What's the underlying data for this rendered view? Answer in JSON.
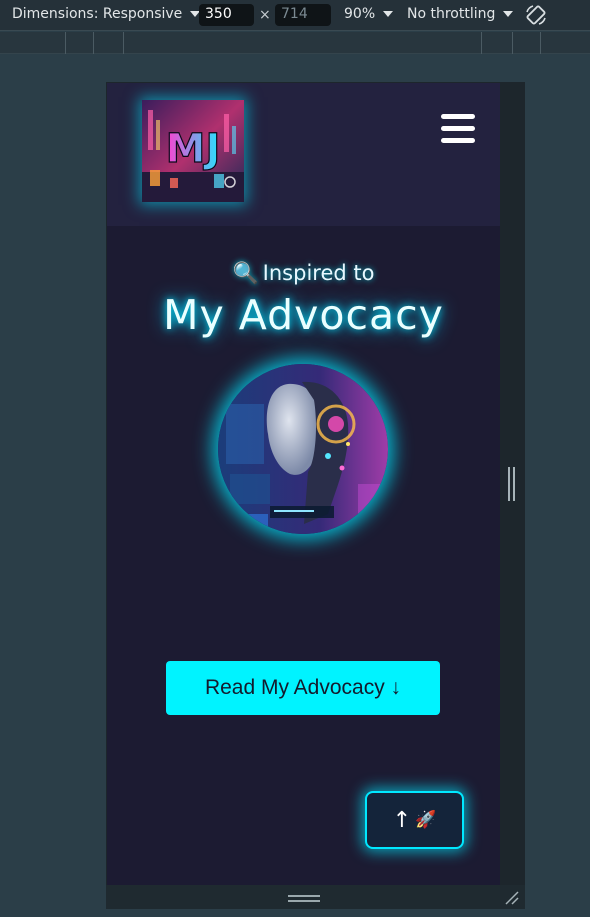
{
  "toolbar": {
    "dimensions_label": "Dimensions: Responsive",
    "width_value": "350",
    "height_placeholder": "714",
    "times": "×",
    "zoom": "90%",
    "throttling": "No throttling"
  },
  "site": {
    "logo_text": "MJ",
    "subtitle_icon": "🔍",
    "subtitle": "Inspired to",
    "title": "My Advocacy",
    "cta_label": "Read My Advocacy ↓",
    "scroll_top_arrow": "↑",
    "scroll_top_icon": "🚀"
  },
  "colors": {
    "accent": "#00f3ff",
    "page_bg": "#1c1b32",
    "header_bg": "#23223f"
  }
}
